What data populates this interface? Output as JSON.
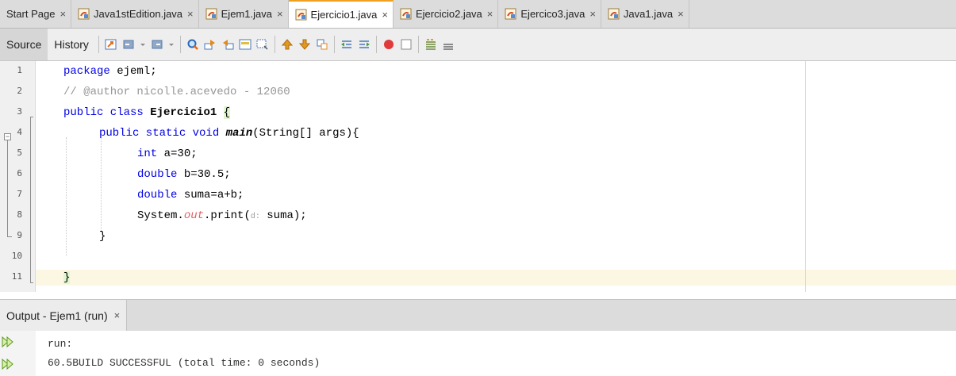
{
  "tabs": [
    {
      "label": "Start Page",
      "icon": "none",
      "active": false
    },
    {
      "label": "Java1stEdition.java",
      "icon": "java-file-icon",
      "active": false
    },
    {
      "label": "Ejem1.java",
      "icon": "java-file-icon",
      "active": false
    },
    {
      "label": "Ejercicio1.java",
      "icon": "java-file-icon",
      "active": true
    },
    {
      "label": "Ejercicio2.java",
      "icon": "java-file-icon",
      "active": false
    },
    {
      "label": "Ejercico3.java",
      "icon": "java-file-icon",
      "active": false
    },
    {
      "label": "Java1.java",
      "icon": "java-file-icon",
      "active": false
    }
  ],
  "tab_close_glyph": "×",
  "toolbar": {
    "source_label": "Source",
    "history_label": "History"
  },
  "editor": {
    "line_numbers": [
      "1",
      "2",
      "3",
      "4",
      "5",
      "6",
      "7",
      "8",
      "9",
      "10",
      "11"
    ],
    "code": {
      "l1_kw": "package",
      "l1_rest": " ejeml;",
      "l2": "// @author nicolle.acevedo - 12060",
      "l3_kw": "public class",
      "l3_name": "Ejercicio1",
      "l3_brace": "{",
      "l4_kw": "public static void",
      "l4_name": "main",
      "l4_rest": "(String[] args){",
      "l5_kw": "int",
      "l5_rest": " a=30;",
      "l6_kw": "double",
      "l6_rest": " b=30.5;",
      "l7_kw": "double",
      "l7_rest": " suma=a+b;",
      "l8_a": "System.",
      "l8_field": "out",
      "l8_b": ".print(",
      "l8_hint": "d:",
      "l8_c": " suma);",
      "l9": "}",
      "l11": "}"
    },
    "colors": {
      "keyword": "#0000e6",
      "comment": "#969696",
      "field": "#e06060",
      "current_line": "#fcf7e2"
    }
  },
  "output": {
    "tab_label": "Output - Ejem1 (run)",
    "lines": [
      "run:",
      "60.5BUILD SUCCESSFUL (total time: 0 seconds)"
    ]
  }
}
